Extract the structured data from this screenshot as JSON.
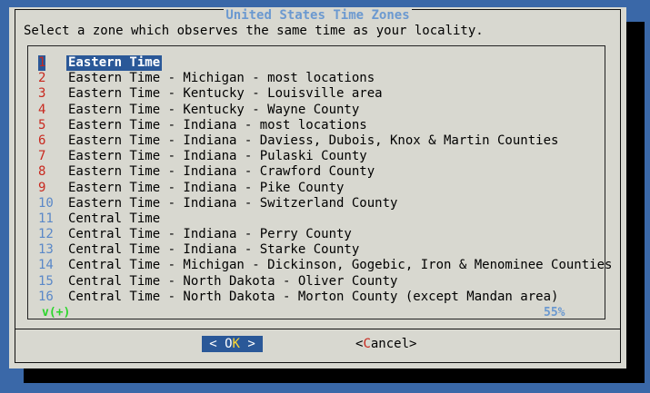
{
  "dialog": {
    "title": "United States Time Zones",
    "prompt": "Select a zone which observes the same time as your locality."
  },
  "list": {
    "items": [
      {
        "tag": "1",
        "label": "Eastern Time"
      },
      {
        "tag": "2",
        "label": "Eastern Time - Michigan - most locations"
      },
      {
        "tag": "3",
        "label": "Eastern Time - Kentucky - Louisville area"
      },
      {
        "tag": "4",
        "label": "Eastern Time - Kentucky - Wayne County"
      },
      {
        "tag": "5",
        "label": "Eastern Time - Indiana - most locations"
      },
      {
        "tag": "6",
        "label": "Eastern Time - Indiana - Daviess, Dubois, Knox & Martin Counties"
      },
      {
        "tag": "7",
        "label": "Eastern Time - Indiana - Pulaski County"
      },
      {
        "tag": "8",
        "label": "Eastern Time - Indiana - Crawford County"
      },
      {
        "tag": "9",
        "label": "Eastern Time - Indiana - Pike County"
      },
      {
        "tag": "10",
        "label": "Eastern Time - Indiana - Switzerland County"
      },
      {
        "tag": "11",
        "label": "Central Time"
      },
      {
        "tag": "12",
        "label": "Central Time - Indiana - Perry County"
      },
      {
        "tag": "13",
        "label": "Central Time - Indiana - Starke County"
      },
      {
        "tag": "14",
        "label": "Central Time - Michigan - Dickinson, Gogebic, Iron & Menominee Counties"
      },
      {
        "tag": "15",
        "label": "Central Time - North Dakota - Oliver County"
      },
      {
        "tag": "16",
        "label": "Central Time - North Dakota - Morton County (except Mandan area)"
      }
    ],
    "scroll_indicator": "v(+)",
    "scroll_percent": "55%"
  },
  "buttons": {
    "ok": {
      "left": "<",
      "pre": " ",
      "hot": "O",
      "rest": "K",
      "right": ">"
    },
    "cancel": {
      "left": "<",
      "hot": "C",
      "rest": "ancel",
      "right": ">"
    }
  },
  "colors": {
    "background": "#3a68a8",
    "dialog": "#d8d8d0",
    "selection": "#2a5898",
    "tag": "#c8281e",
    "title": "#6b99d0",
    "scroll_more": "#2bd52b"
  }
}
